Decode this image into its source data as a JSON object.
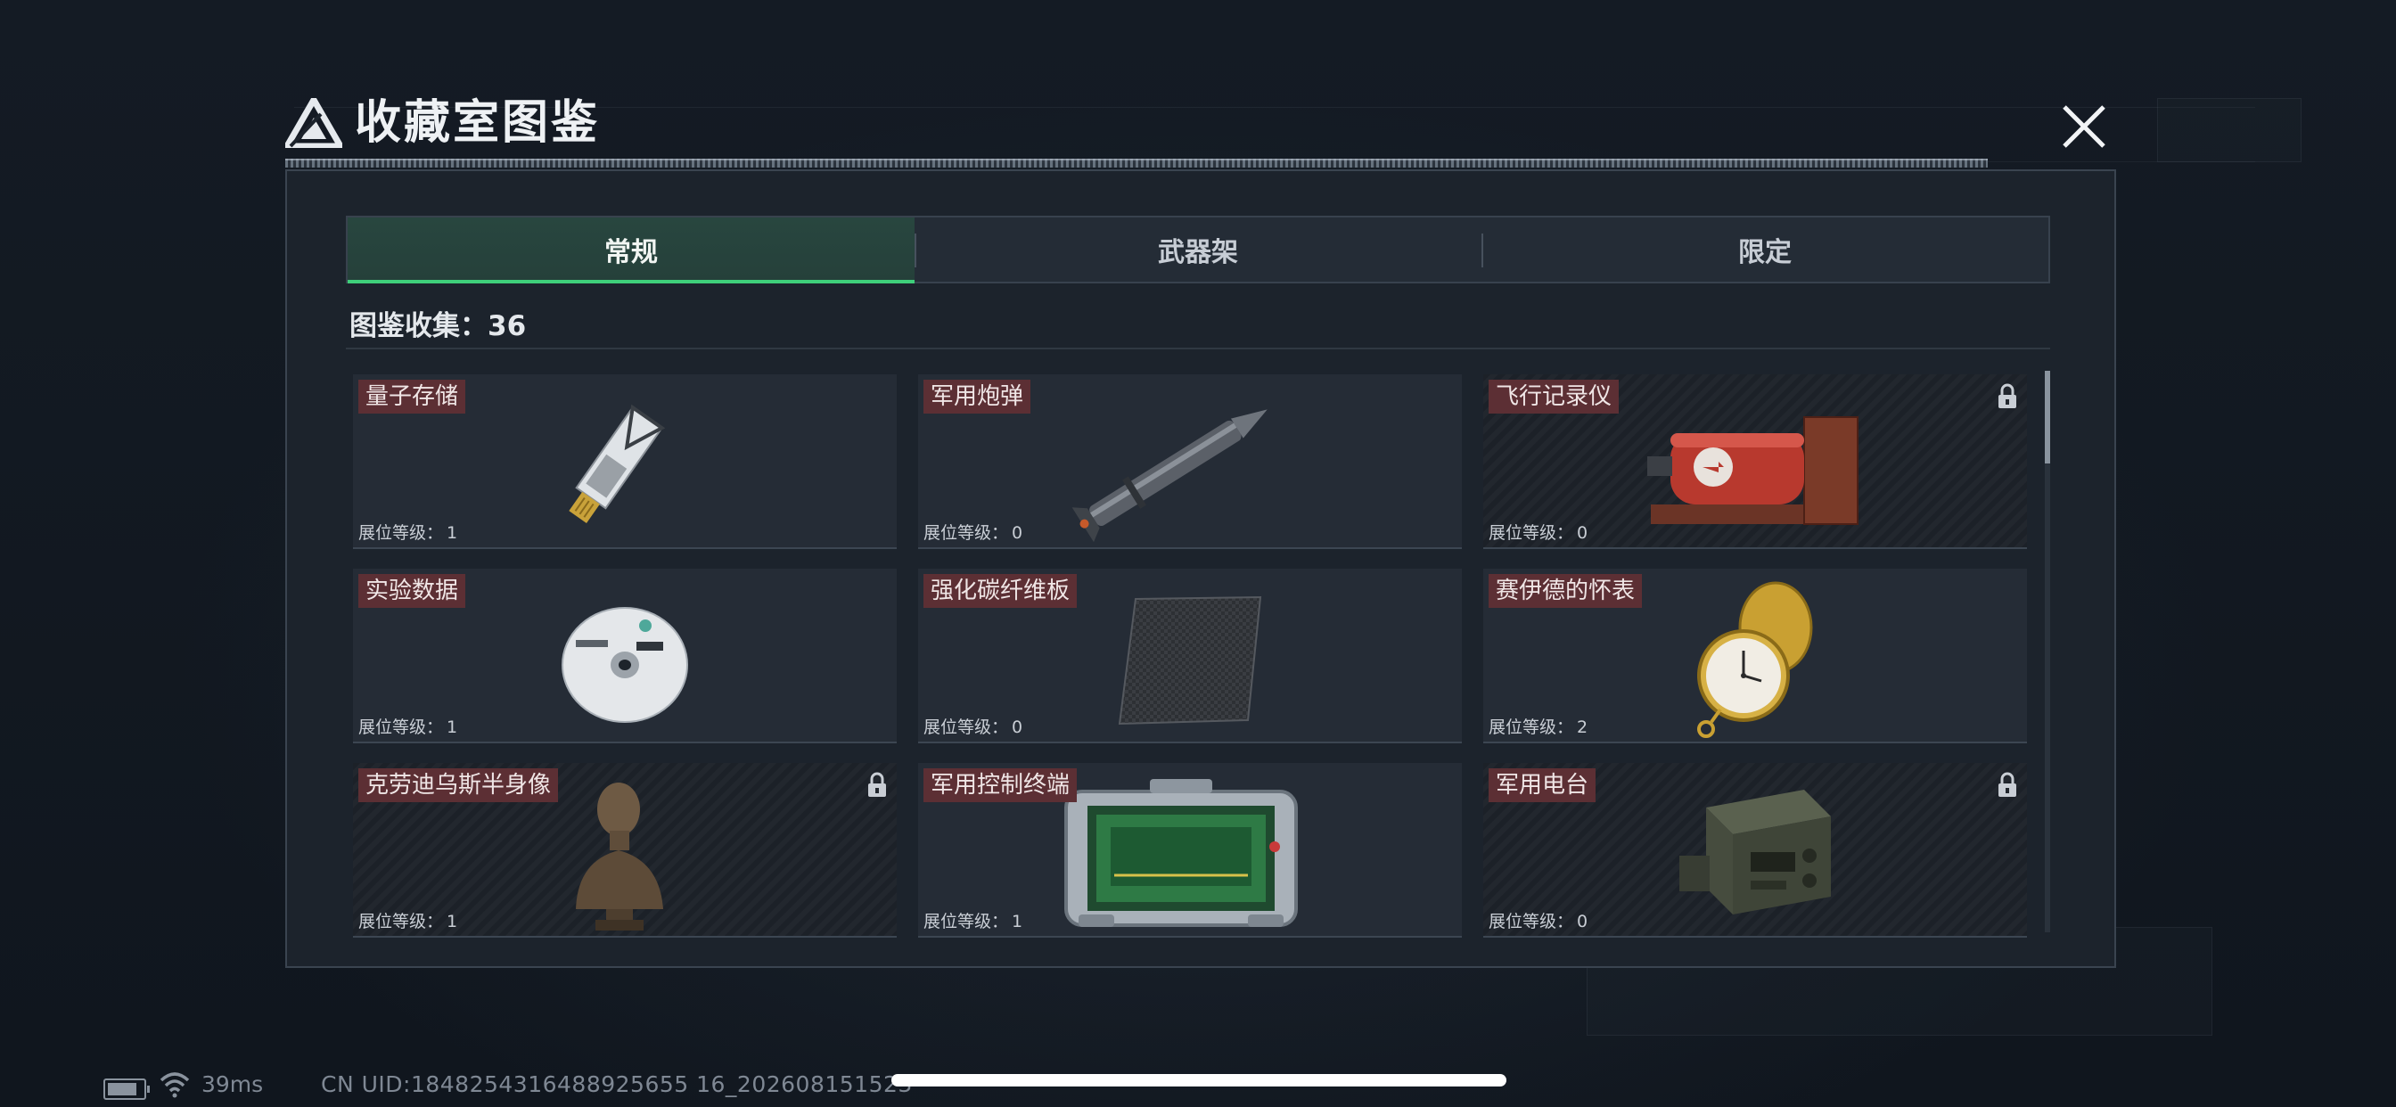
{
  "dialog": {
    "title": "收藏室图鉴",
    "logo_icon": "delta-triangle-icon",
    "close_icon": "close-icon"
  },
  "tabs": [
    {
      "label": "常规",
      "active": true
    },
    {
      "label": "武器架",
      "active": false
    },
    {
      "label": "限定",
      "active": false
    }
  ],
  "collection": {
    "label": "图鉴收集：",
    "count": "36"
  },
  "level_label": "展位等级：",
  "items": [
    {
      "name": "量子存储",
      "level": "1",
      "locked": false,
      "icon": "usb-drive-icon"
    },
    {
      "name": "军用炮弹",
      "level": "0",
      "locked": false,
      "icon": "artillery-shell-icon"
    },
    {
      "name": "飞行记录仪",
      "level": "0",
      "locked": true,
      "icon": "flight-recorder-icon"
    },
    {
      "name": "实验数据",
      "level": "1",
      "locked": false,
      "icon": "data-disc-icon"
    },
    {
      "name": "强化碳纤维板",
      "level": "0",
      "locked": false,
      "icon": "carbon-plate-icon"
    },
    {
      "name": "赛伊德的怀表",
      "level": "2",
      "locked": false,
      "icon": "pocket-watch-icon"
    },
    {
      "name": "克劳迪乌斯半身像",
      "level": "1",
      "locked": true,
      "icon": "bust-statue-icon"
    },
    {
      "name": "军用控制终端",
      "level": "1",
      "locked": false,
      "icon": "control-terminal-icon"
    },
    {
      "name": "军用电台",
      "level": "0",
      "locked": true,
      "icon": "military-radio-icon"
    }
  ],
  "colors": {
    "accent": "#3ecf7a",
    "name_tag": "#5c2f34",
    "panel": "#1c232c"
  },
  "status_bar": {
    "ping": "39ms",
    "uid": "CN UID:1848254316488925655 16_202608151523"
  }
}
